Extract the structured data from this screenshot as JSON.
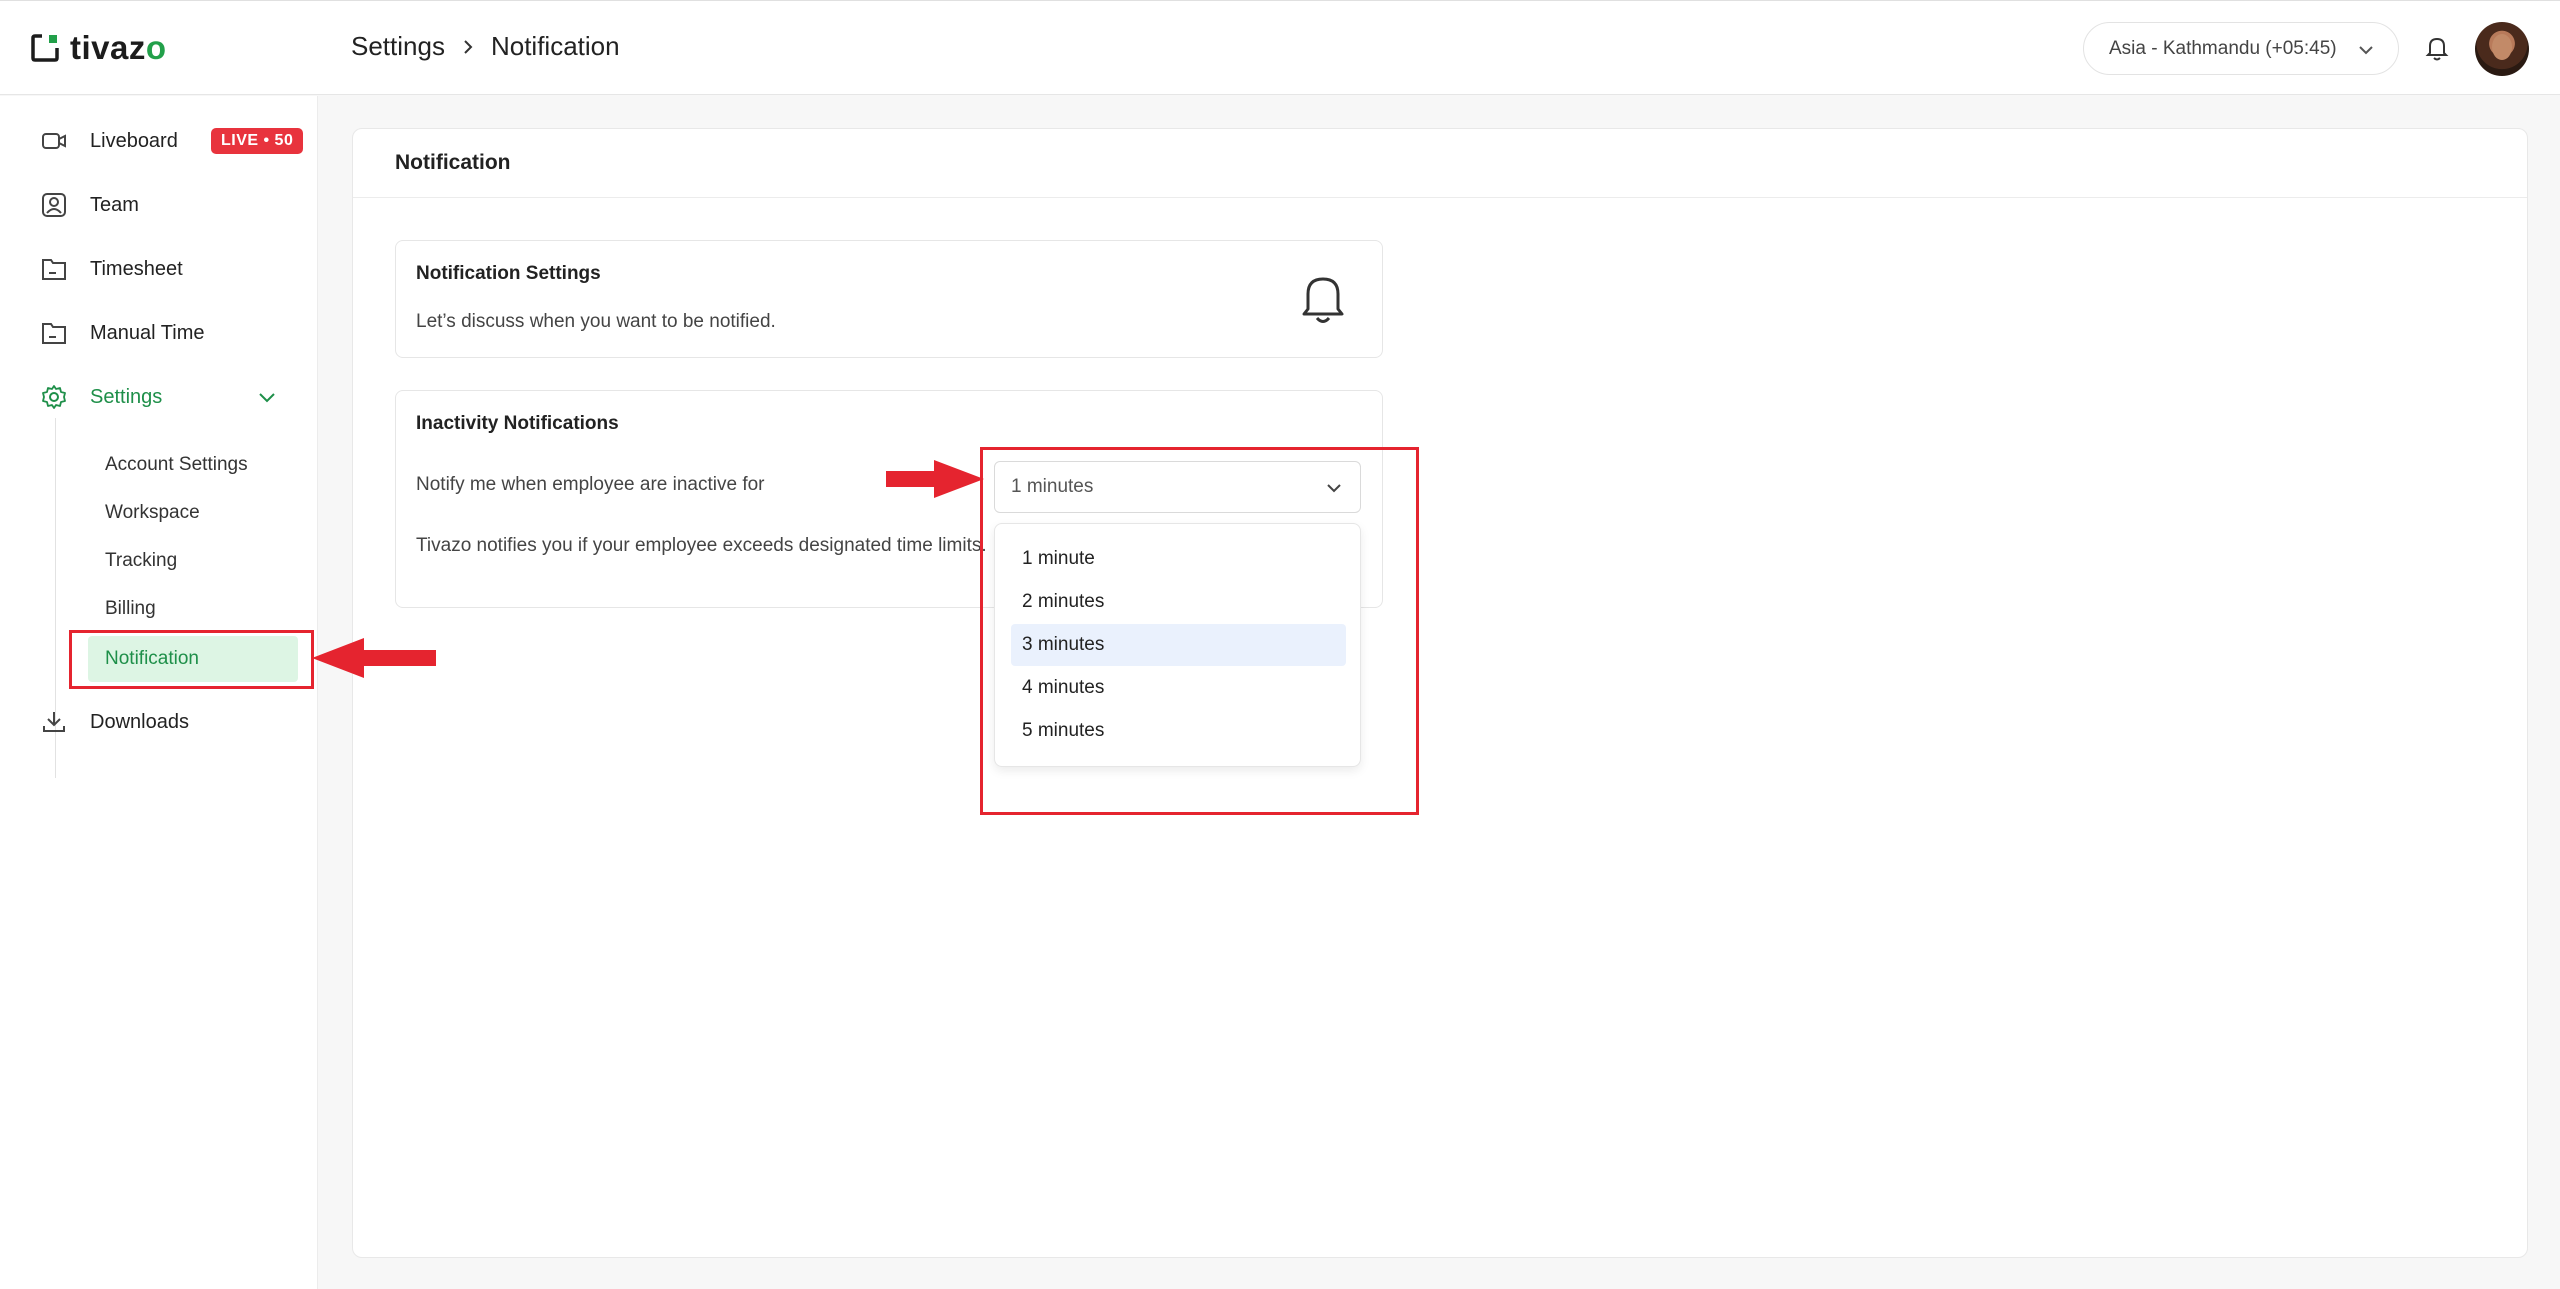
{
  "header": {
    "logo_text_main": "tivaz",
    "logo_text_accent": "o",
    "breadcrumb": [
      "Settings",
      "Notification"
    ],
    "timezone": "Asia - Kathmandu (+05:45)"
  },
  "sidebar": {
    "items": [
      {
        "label": "Liveboard",
        "badge": "LIVE • 50"
      },
      {
        "label": "Team"
      },
      {
        "label": "Timesheet"
      },
      {
        "label": "Manual Time"
      },
      {
        "label": "Settings"
      },
      {
        "label": "Downloads"
      }
    ],
    "settings_sub": [
      "Account Settings",
      "Workspace",
      "Tracking",
      "Billing",
      "Notification"
    ]
  },
  "main": {
    "title": "Notification",
    "settings_box": {
      "title": "Notification Settings",
      "text": "Let’s discuss when you want to be notified."
    },
    "inactivity_box": {
      "title": "Inactivity Notifications",
      "label": "Notify me when employee are inactive for",
      "note": "Tivazo notifies you if your employee exceeds designated time limits.",
      "selected": "1 minutes",
      "options": [
        "1 minute",
        "2 minutes",
        "3 minutes",
        "4 minutes",
        "5 minutes"
      ]
    }
  },
  "colors": {
    "brand_green": "#1e8f49",
    "annotation_red": "#e5242f",
    "live_red": "#e8333d"
  }
}
